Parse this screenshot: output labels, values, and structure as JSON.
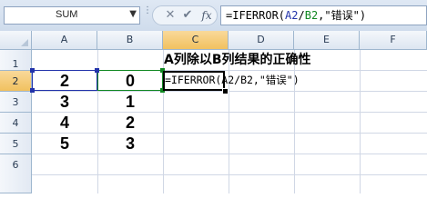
{
  "formula_bar": {
    "name_box": "SUM",
    "name_box_dropdown_icon": "chevron-down-icon",
    "cancel_icon": "close-icon",
    "enter_icon": "checkmark-icon",
    "fx_label": "fx",
    "formula_prefix": "=IFERROR(",
    "formula_ref_a": "A2",
    "formula_sep": "/",
    "formula_ref_b": "B2",
    "formula_suffix": ",\"错误\")"
  },
  "columns": [
    "A",
    "B",
    "C",
    "D",
    "E",
    "F"
  ],
  "rows": [
    "1",
    "2",
    "3",
    "4",
    "5",
    "6"
  ],
  "active_column": "C",
  "active_row": "2",
  "cells": {
    "C1": "A列除以B列结果的正确性",
    "A2": "2",
    "B2": "0",
    "A3": "3",
    "B3": "1",
    "A4": "4",
    "B4": "2",
    "A5": "5",
    "B5": "3",
    "C2": "=IFERROR(A2/B2,\"错误\")"
  },
  "colors": {
    "ref_a": "#2233aa",
    "ref_b": "#118822",
    "header_active": "#f1c15f"
  }
}
